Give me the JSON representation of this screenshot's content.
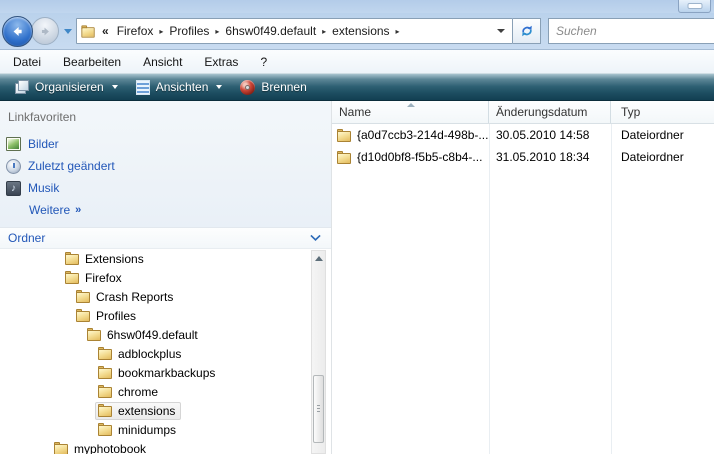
{
  "nav": {
    "address": {
      "chevrons_prefix": "«",
      "crumbs": [
        "Firefox",
        "Profiles",
        "6hsw0f49.default",
        "extensions"
      ]
    },
    "search": {
      "placeholder": "Suchen"
    }
  },
  "menubar": {
    "items": [
      "Datei",
      "Bearbeiten",
      "Ansicht",
      "Extras",
      "?"
    ]
  },
  "toolbar": {
    "buttons": [
      {
        "label": "Organisieren",
        "icon": "organize-icon",
        "has_dropdown": true
      },
      {
        "label": "Ansichten",
        "icon": "views-icon",
        "has_dropdown": true
      },
      {
        "label": "Brennen",
        "icon": "burn-icon",
        "has_dropdown": false
      }
    ]
  },
  "sidebar": {
    "favorites": {
      "header": "Linkfavoriten",
      "links": [
        {
          "label": "Bilder",
          "icon": "pictures-icon"
        },
        {
          "label": "Zuletzt geändert",
          "icon": "recent-icon"
        },
        {
          "label": "Musik",
          "icon": "music-icon"
        },
        {
          "label": "Weitere",
          "suffix": "»",
          "icon": "none"
        }
      ]
    },
    "folders_panel": {
      "header": "Ordner",
      "tree": [
        {
          "label": "Extensions",
          "level": 1,
          "selected": false
        },
        {
          "label": "Firefox",
          "level": 1,
          "selected": false
        },
        {
          "label": "Crash Reports",
          "level": 2,
          "selected": false
        },
        {
          "label": "Profiles",
          "level": 2,
          "selected": false
        },
        {
          "label": "6hsw0f49.default",
          "level": 3,
          "selected": false
        },
        {
          "label": "adblockplus",
          "level": 4,
          "selected": false
        },
        {
          "label": "bookmarkbackups",
          "level": 4,
          "selected": false
        },
        {
          "label": "chrome",
          "level": 4,
          "selected": false
        },
        {
          "label": "extensions",
          "level": 4,
          "selected": true
        },
        {
          "label": "minidumps",
          "level": 4,
          "selected": false
        },
        {
          "label": "myphotobook",
          "level": 0,
          "selected": false
        }
      ]
    }
  },
  "filelist": {
    "columns": [
      {
        "label": "Name",
        "sort": "asc",
        "width": 157
      },
      {
        "label": "Änderungsdatum",
        "sort": null,
        "width": 122
      },
      {
        "label": "Typ",
        "sort": null,
        "width": null
      }
    ],
    "rows": [
      {
        "name": "{a0d7ccb3-214d-498b-...",
        "modified": "30.05.2010 14:58",
        "type": "Dateiordner"
      },
      {
        "name": "{d10d0bf8-f5b5-c8b4-...",
        "modified": "31.05.2010 18:34",
        "type": "Dateiordner"
      }
    ]
  },
  "colors": {
    "chrome_blue": "#bad2ec",
    "toolbar_top": "#a8c3ce",
    "toolbar_bottom": "#123f52",
    "link_blue": "#2257b8",
    "selection_border": "#d5d5d5",
    "folder_yellow": "#f2d98c"
  }
}
